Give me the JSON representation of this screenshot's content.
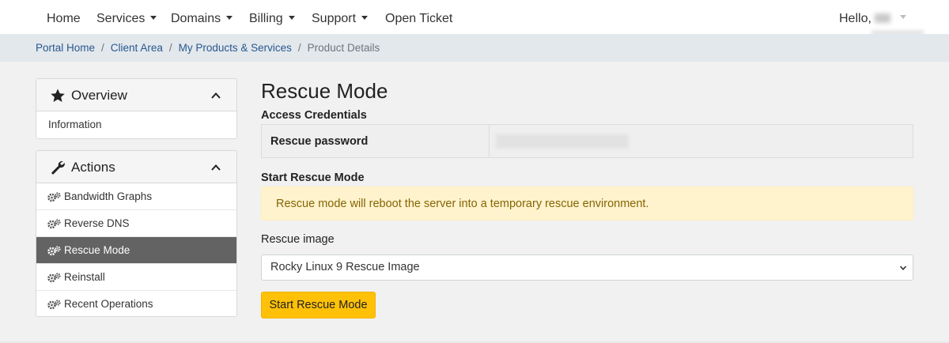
{
  "nav": {
    "home": "Home",
    "services": "Services",
    "domains": "Domains",
    "billing": "Billing",
    "support": "Support",
    "open_ticket": "Open Ticket",
    "hello": "Hello,"
  },
  "breadcrumb": {
    "items": [
      "Portal Home",
      "Client Area",
      "My Products & Services"
    ],
    "current": "Product Details"
  },
  "sidebar": {
    "overview": {
      "title": "Overview",
      "items": [
        "Information"
      ]
    },
    "actions": {
      "title": "Actions",
      "items": [
        "Bandwidth Graphs",
        "Reverse DNS",
        "Rescue Mode",
        "Reinstall",
        "Recent Operations"
      ],
      "active_item": "Rescue Mode"
    }
  },
  "main": {
    "title": "Rescue Mode",
    "access_credentials_heading": "Access Credentials",
    "rescue_password_label": "Rescue password",
    "start_heading": "Start Rescue Mode",
    "alert_text": "Rescue mode will reboot the server into a temporary rescue environment.",
    "image_label": "Rescue image",
    "image_selected": "Rocky Linux 9 Rescue Image",
    "start_button": "Start Rescue Mode"
  },
  "colors": {
    "accent": "#ffc107",
    "link": "#28578f",
    "active_item_bg": "#636363",
    "alert_bg": "#fff3cd",
    "alert_text": "#856404"
  },
  "icons": {
    "overview": "star-icon",
    "actions": "wrench-icon",
    "action_items": "gears-icon",
    "collapse": "chevron-up-icon",
    "select": "chevron-down-icon"
  }
}
